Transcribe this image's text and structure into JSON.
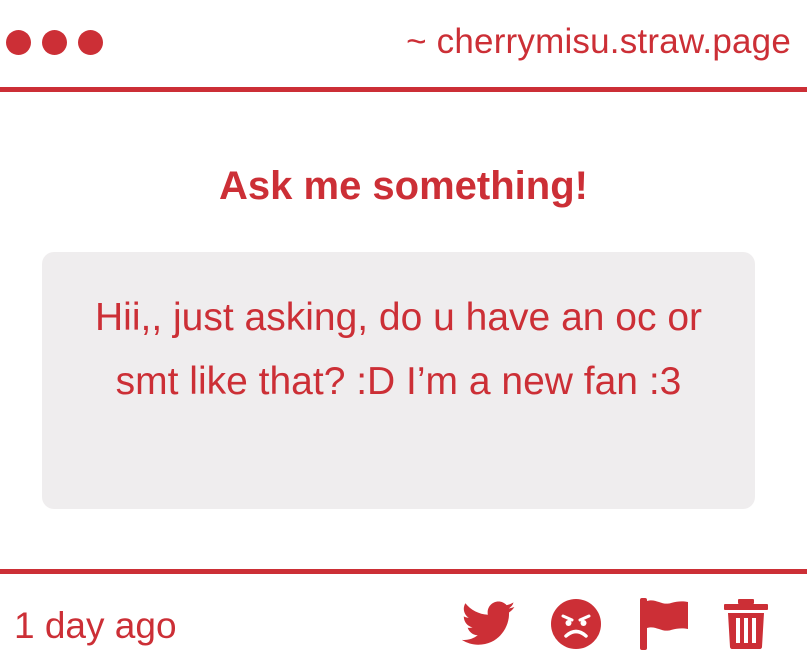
{
  "header": {
    "site_url": "~ cherrymisu.straw.page",
    "window_controls": [
      "dot",
      "dot",
      "dot"
    ]
  },
  "main": {
    "title": "Ask me something!",
    "question": "Hii,, just asking, do u have an oc or smt like that? :D I’m a new fan :3"
  },
  "footer": {
    "timestamp": "1 day ago",
    "actions": [
      "twitter-icon",
      "angry-face-icon",
      "flag-icon",
      "trash-icon"
    ]
  },
  "colors": {
    "accent": "#cc2f36",
    "card_background": "#efedee",
    "page_background": "#ffffff"
  }
}
